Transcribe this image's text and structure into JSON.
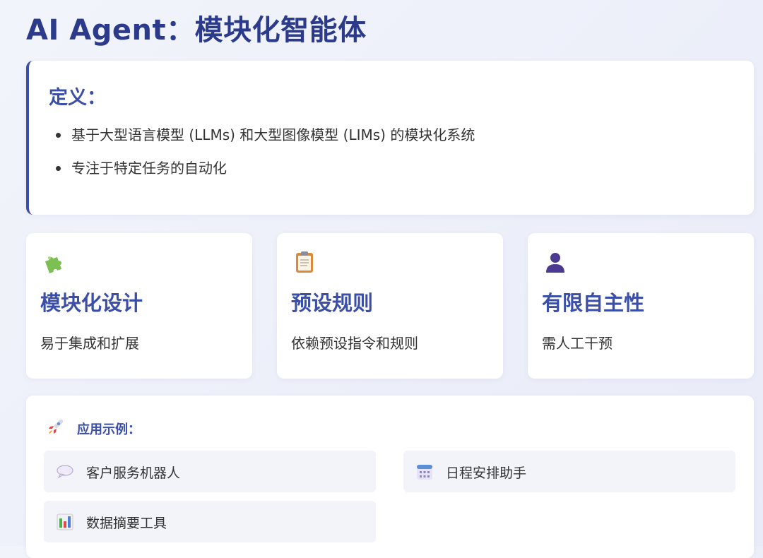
{
  "page": {
    "title": "AI Agent：模块化智能体"
  },
  "definition": {
    "heading": "定义：",
    "items": [
      "基于大型语言模型 (LLMs) 和大型图像模型 (LIMs) 的模块化系统",
      "专注于特定任务的自动化"
    ]
  },
  "features": [
    {
      "icon": "puzzle-piece-icon",
      "title": "模块化设计",
      "description": "易于集成和扩展"
    },
    {
      "icon": "clipboard-icon",
      "title": "预设规则",
      "description": "依赖预设指令和规则"
    },
    {
      "icon": "person-silhouette-icon",
      "title": "有限自主性",
      "description": "需人工干预"
    }
  ],
  "examples": {
    "icon": "rocket-icon",
    "heading": "应用示例：",
    "items": [
      {
        "icon": "speech-bubble-icon",
        "label": "客户服务机器人"
      },
      {
        "icon": "calendar-icon",
        "label": "日程安排助手"
      },
      {
        "icon": "bar-chart-icon",
        "label": "数据摘要工具"
      }
    ]
  },
  "colors": {
    "accent": "#3b4fa8",
    "title": "#2c3a8c",
    "card_background": "#ffffff",
    "item_background": "#f3f4f9"
  }
}
